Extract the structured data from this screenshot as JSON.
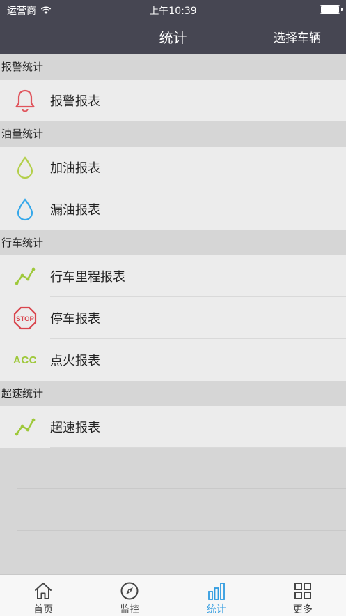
{
  "status_bar": {
    "carrier": "运营商",
    "time": "上午10:39"
  },
  "nav": {
    "title": "统计",
    "right_button": "选择车辆"
  },
  "sections": [
    {
      "header": "报警统计",
      "items": [
        {
          "label": "报警报表",
          "icon": "bell-icon"
        }
      ]
    },
    {
      "header": "油量统计",
      "items": [
        {
          "label": "加油报表",
          "icon": "drop-outline-icon"
        },
        {
          "label": "漏油报表",
          "icon": "drop-icon"
        }
      ]
    },
    {
      "header": "行车统计",
      "items": [
        {
          "label": "行车里程报表",
          "icon": "trend-line-icon"
        },
        {
          "label": "停车报表",
          "icon": "stop-sign-icon"
        },
        {
          "label": "点火报表",
          "icon": "acc-icon"
        }
      ]
    },
    {
      "header": "超速统计",
      "items": [
        {
          "label": "超速报表",
          "icon": "trend-line-icon"
        }
      ]
    }
  ],
  "acc_text": "ACC",
  "stop_text": "STOP",
  "tabs": [
    {
      "label": "首页",
      "icon": "home-icon"
    },
    {
      "label": "监控",
      "icon": "compass-icon"
    },
    {
      "label": "统计",
      "icon": "bar-chart-icon",
      "active": true
    },
    {
      "label": "更多",
      "icon": "grid-icon"
    }
  ],
  "colors": {
    "nav_bg": "#464652",
    "accent": "#2f9be0",
    "alarm_red": "#e0545c",
    "oil_green": "#b3cf4a",
    "oil_blue": "#35a8ea",
    "trend_green": "#9ec83a",
    "stop_red": "#d9454d",
    "acc_green": "#9ec83a"
  }
}
